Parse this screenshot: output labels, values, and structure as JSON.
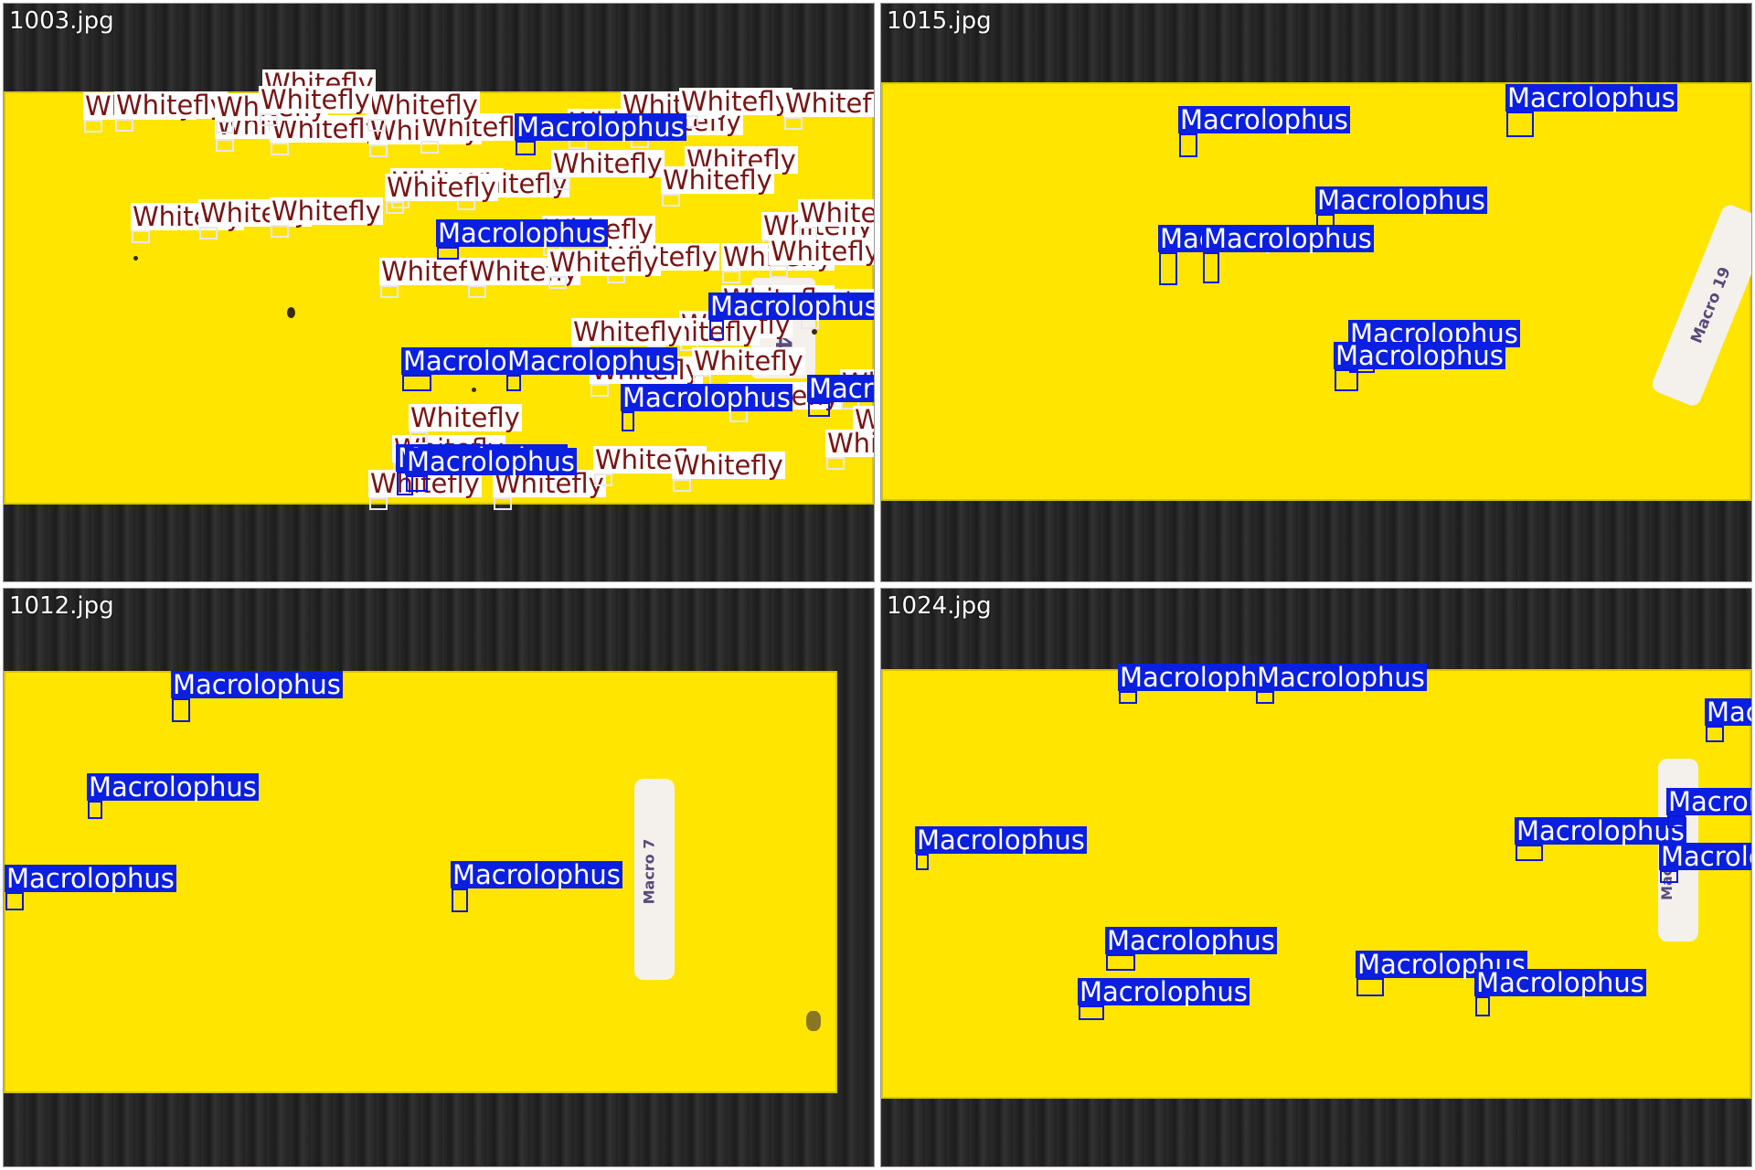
{
  "colors": {
    "macrolophus_label_bg": "#0b1fe0",
    "macrolophus_label_text": "#ffffff",
    "whitefly_label_bg": "#ffffff",
    "whitefly_label_text": "#7a1414",
    "trap_yellow": "#ffe500"
  },
  "classes": {
    "whitefly": "Whitefly",
    "macrolophus": "Macrolophus"
  },
  "panels": [
    {
      "filename": "1003.jpg",
      "tag_text": "254",
      "detection_counts": {
        "Whitefly": 50,
        "Macrolophus": 9
      }
    },
    {
      "filename": "1015.jpg",
      "tag_text": "Macro 19",
      "detection_counts": {
        "Macrolophus": 7
      }
    },
    {
      "filename": "1012.jpg",
      "tag_text": "Macro 7",
      "detection_counts": {
        "Macrolophus": 4
      }
    },
    {
      "filename": "1024.jpg",
      "tag_text": "Macro 14",
      "detection_counts": {
        "Macrolophus": 11
      }
    }
  ]
}
